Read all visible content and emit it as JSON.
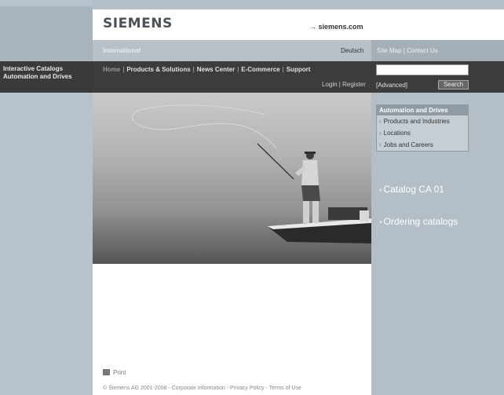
{
  "sidebar": {
    "catalog_line1": "Interactive Catalogs",
    "catalog_line2": "Automation and Drives"
  },
  "header": {
    "logo": "SIEMENS",
    "site_link": "→ siemens.com",
    "international": "International",
    "deutsch": "Deutsch",
    "site_map": "Site Map",
    "contact_us": "Contact Us"
  },
  "nav": {
    "items": [
      "Home",
      "Products & Solutions",
      "News Center",
      "E-Commerce",
      "Support"
    ],
    "login": "Login",
    "register": "Register"
  },
  "search": {
    "advanced": "[Advanced]",
    "button": "Search",
    "value": ""
  },
  "ad_box": {
    "title": "Automation and Drives",
    "items": [
      "Products and Industries",
      "Locations",
      "Jobs and Careers"
    ]
  },
  "links": {
    "catalog": "Catalog CA 01",
    "ordering": "Ordering catalogs"
  },
  "footer": {
    "print": "Print",
    "copyright": "© Siemens AG 2001-2008 - Corporate Information - Privacy Policy - Terms of Use"
  }
}
